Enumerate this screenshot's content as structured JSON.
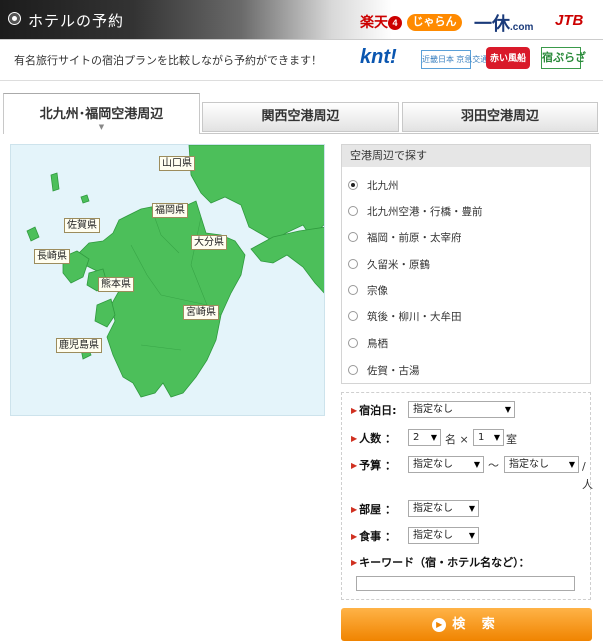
{
  "header": {
    "title": "ホテルの予約",
    "subtitle": "有名旅行サイトの宿泊プランを比較しながら予約ができます！"
  },
  "logos": {
    "rakuten": "楽天",
    "rakuten_mark": "4",
    "jalan": "じゃらん",
    "ikkyu": "一休",
    "ikkyu_suffix": ".com",
    "jtb": "JTB",
    "knt": "knt!",
    "kyuko": "近畿日本 京急交通社",
    "akai": "赤い風船",
    "yado": "宿ぷらざ"
  },
  "tabs": [
    {
      "label": "北九州･福岡空港周辺",
      "active": true
    },
    {
      "label": "関西空港周辺",
      "active": false
    },
    {
      "label": "羽田空港周辺",
      "active": false
    }
  ],
  "map": {
    "land_color": "#4cbf5a",
    "sea_color": "#e4f4fa",
    "prefectures": [
      "山口県",
      "福岡県",
      "佐賀県",
      "大分県",
      "長崎県",
      "熊本県",
      "宮崎県",
      "鹿児島県"
    ]
  },
  "area_search": {
    "heading": "空港周辺で探す",
    "selected_index": 0,
    "items": [
      "北九州",
      "北九州空港・行橋・豊前",
      "福岡・前原・太宰府",
      "久留米・原鶴",
      "宗像",
      "筑後・柳川・大牟田",
      "鳥栖",
      "佐賀・古湯"
    ]
  },
  "form": {
    "date_label": "宿泊日:",
    "date_value": "指定なし",
    "people_label": "人数 ：",
    "people_value": "2",
    "people_unit": "名 ×",
    "rooms_value": "1",
    "rooms_unit": "室",
    "budget_label": "予算 ：",
    "budget_min": "指定なし",
    "budget_sep": "～",
    "budget_max": "指定なし",
    "budget_unit": "/ 人",
    "room_label": "部屋 ：",
    "room_value": "指定なし",
    "meal_label": "食事 ：",
    "meal_value": "指定なし",
    "keyword_label": "キーワード（宿・ホテル名など）：",
    "keyword_value": "",
    "search_button": "検 索"
  },
  "colors": {
    "accent_orange": "#f08400",
    "header_dark": "#1c1c1c"
  }
}
